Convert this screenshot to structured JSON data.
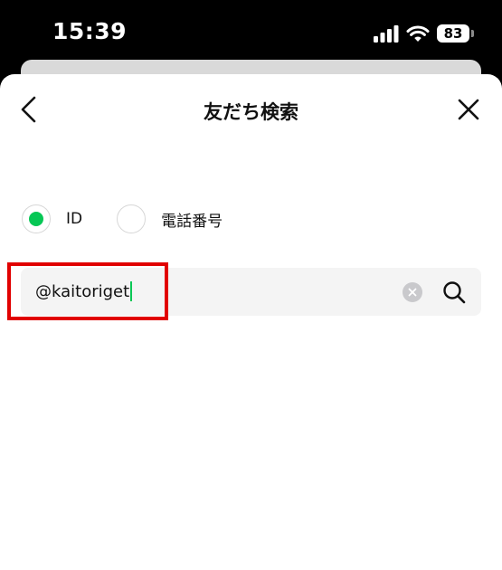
{
  "status_bar": {
    "time": "15:39",
    "battery": "83"
  },
  "header": {
    "title": "友だち検索",
    "back_icon": "chevron-left-icon",
    "close_icon": "close-icon"
  },
  "search_type": {
    "options": [
      {
        "label": "ID",
        "selected": true
      },
      {
        "label": "電話番号",
        "selected": false
      }
    ],
    "selected_color": "#06c755"
  },
  "search": {
    "value": "@kaitoriget",
    "caret_color": "#06c755",
    "clear_icon": "clear-icon",
    "search_icon": "search-icon"
  },
  "annotation": {
    "highlight_color": "#e10000"
  }
}
